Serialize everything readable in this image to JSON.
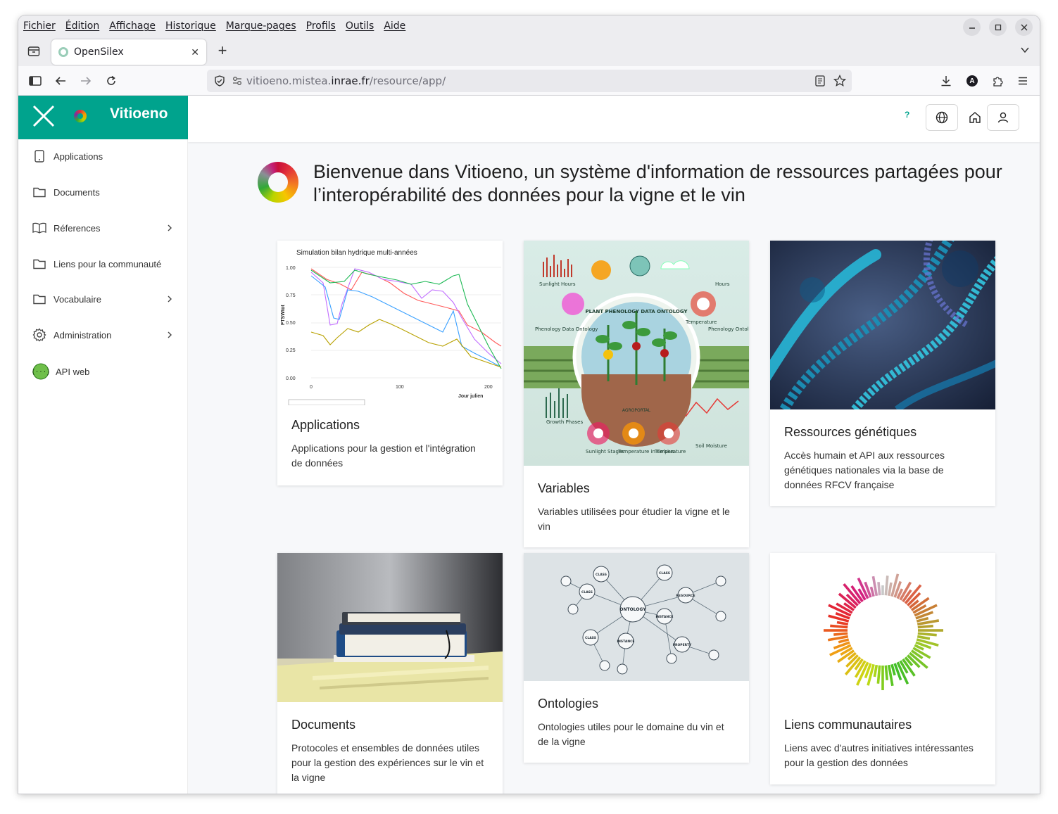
{
  "menu": [
    "Fichier",
    "Édition",
    "Affichage",
    "Historique",
    "Marque-pages",
    "Profils",
    "Outils",
    "Aide"
  ],
  "tab": {
    "title": "OpenSilex"
  },
  "url": {
    "prefix": "vitioeno.mistea.",
    "host": "inrae.fr",
    "path": "/resource/app/"
  },
  "brand": {
    "title": "Vitioeno"
  },
  "topbar": {
    "help": "?"
  },
  "sidebar": {
    "items": [
      {
        "label": "Applications",
        "icon": "tablet-icon",
        "chevron": false
      },
      {
        "label": "Documents",
        "icon": "folder-icon",
        "chevron": false
      },
      {
        "label": "Réferences",
        "icon": "book-icon",
        "chevron": true
      },
      {
        "label": "Liens pour la communauté",
        "icon": "folder-icon",
        "chevron": false
      },
      {
        "label": "Vocabulaire",
        "icon": "folder-icon",
        "chevron": true
      },
      {
        "label": "Administration",
        "icon": "gear-icon",
        "chevron": true
      },
      {
        "label": "API web",
        "icon": "api-icon",
        "chevron": false
      }
    ]
  },
  "hero": {
    "title": "Bienvenue dans Vitioeno, un système d'information de ressources partagées pour l’interopérabilité des données pour la vigne et le vin"
  },
  "cards": [
    {
      "title": "Applications",
      "text": "Applications pour la gestion et l'intégration de données"
    },
    {
      "title": "Variables",
      "text": "Variables utilisées pour étudier la vigne et le vin"
    },
    {
      "title": "Ressources génétiques",
      "text": "Accès humain et API aux ressources génétiques nationales via la base de données RFCV française"
    },
    {
      "title": "Documents",
      "text": "Protocoles et ensembles de données utiles pour la gestion des expériences sur le vin et la vigne"
    },
    {
      "title": "Ontologies",
      "text": "Ontologies utiles pour le domaine du vin et de la vigne"
    },
    {
      "title": "Liens communautaires",
      "text": "Liens avec d'autres initiatives intéressantes pour la gestion des données"
    }
  ],
  "thumb_chart": {
    "title": "Simulation bilan hydrique multi-années",
    "ylabel": "FTSWtot",
    "xlabel": "Jour julien",
    "yticks": [
      "1.00",
      "0.75",
      "0.50",
      "0.25",
      "0.00"
    ],
    "xticks": [
      "0",
      "100",
      "200"
    ]
  },
  "thumb_variables": {
    "center": "PLANT PHENOLOGY DATA ONTOLOGY",
    "labels": [
      "Sunlight Hours",
      "Hours",
      "Phenology Data Ontology",
      "Temperature",
      "Phenology Ontologies",
      "Growth Phases",
      "Sunlight Stages",
      "Temperature in Celsius",
      "Temperature",
      "Soil Moisture",
      "AGROPORTAL"
    ]
  },
  "thumb_ontology": {
    "center": "ONTOLOGY",
    "nodes": [
      "CLASS",
      "CLASS",
      "CLASS",
      "INSTANCE",
      "CLASS",
      "INSTANCE",
      "PROPERTY",
      "RESOURCE"
    ]
  }
}
